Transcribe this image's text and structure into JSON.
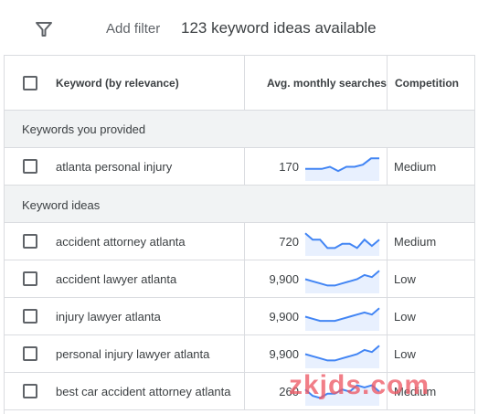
{
  "toolbar": {
    "filter_icon": "filter-icon",
    "add_filter_label": "Add filter",
    "idea_count_text": "123 keyword ideas available"
  },
  "table": {
    "columns": {
      "keyword": "Keyword (by relevance)",
      "searches": "Avg. monthly searches",
      "competition": "Competition"
    },
    "sections": {
      "provided": "Keywords you provided",
      "ideas": "Keyword ideas"
    },
    "rows": [
      {
        "keyword": "atlanta personal injury",
        "searches": "170",
        "competition": "Medium",
        "trend": [
          4,
          4,
          4,
          5,
          3,
          5,
          5,
          6,
          9,
          9
        ]
      },
      {
        "keyword": "accident attorney atlanta",
        "searches": "720",
        "competition": "Medium",
        "trend": [
          9,
          6,
          6,
          2,
          2,
          4,
          4,
          2,
          6,
          3,
          6
        ]
      },
      {
        "keyword": "accident lawyer atlanta",
        "searches": "9,900",
        "competition": "Low",
        "trend": [
          5,
          4,
          3,
          2,
          2,
          3,
          4,
          5,
          7,
          6,
          9
        ]
      },
      {
        "keyword": "injury lawyer atlanta",
        "searches": "9,900",
        "competition": "Low",
        "trend": [
          5,
          4,
          3,
          3,
          3,
          4,
          5,
          6,
          7,
          6,
          9
        ]
      },
      {
        "keyword": "personal injury lawyer atlanta",
        "searches": "9,900",
        "competition": "Low",
        "trend": [
          5,
          4,
          3,
          2,
          2,
          3,
          4,
          5,
          7,
          6,
          9
        ]
      },
      {
        "keyword": "best car accident attorney atlanta",
        "searches": "260",
        "competition": "Medium",
        "trend": [
          6,
          3,
          2,
          4,
          4,
          6,
          5,
          8,
          7,
          8,
          5
        ]
      }
    ]
  },
  "colors": {
    "trend_line": "#4285f4",
    "trend_fill": "#e8f0fe",
    "section_bg": "#f1f3f4",
    "watermark": "#ee5a66"
  },
  "watermark": "zkjds.com"
}
